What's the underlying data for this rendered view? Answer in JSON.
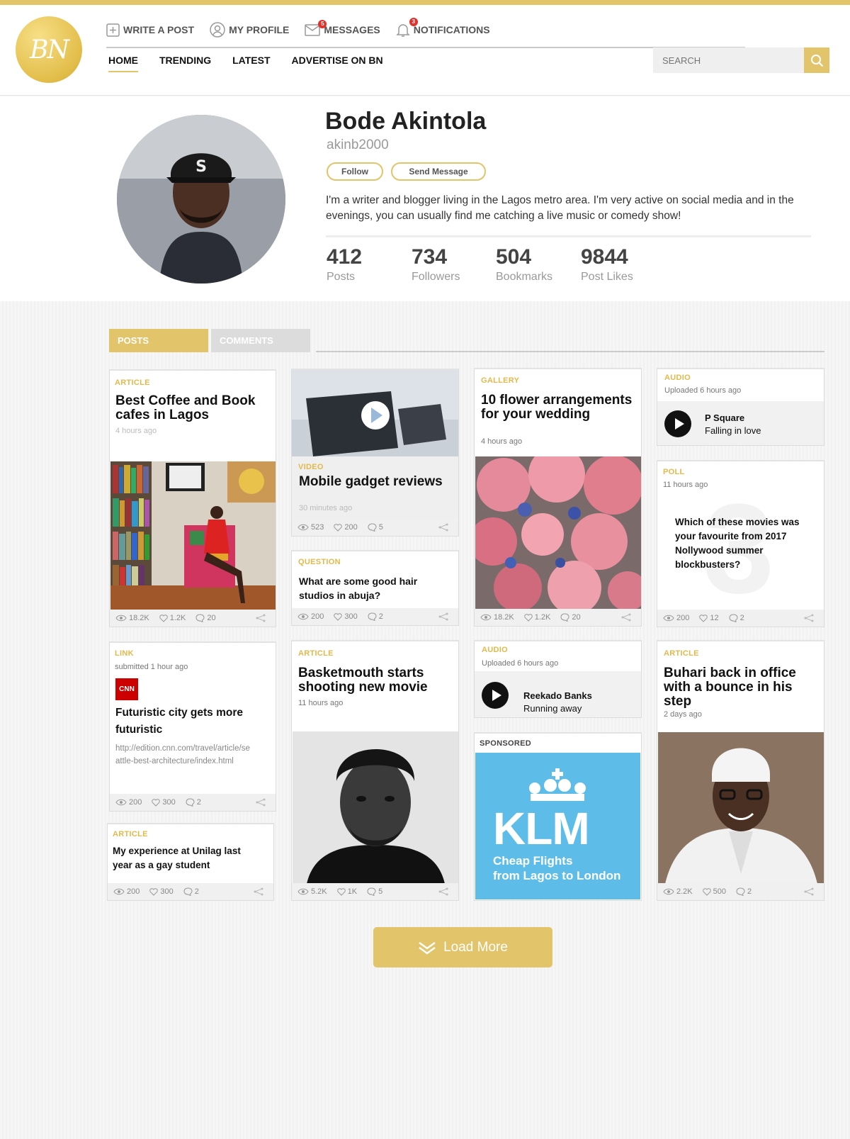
{
  "colors": {
    "accent": "#e2c46a",
    "accent_dark": "#e2b94c",
    "badge": "#e0322b",
    "klm_blue": "#5ebde8"
  },
  "logo": {
    "text": "BN"
  },
  "toolbar": {
    "write_post": "WRITE A POST",
    "my_profile": "MY PROFILE",
    "messages": "MESSAGES",
    "messages_badge": "5",
    "notifications": "NOTIFICATIONS",
    "notifications_badge": "3"
  },
  "nav": {
    "home": "HOME",
    "trending": "TRENDING",
    "latest": "LATEST",
    "advertise": "ADVERTISE ON BN"
  },
  "search": {
    "placeholder": "SEARCH"
  },
  "profile": {
    "name": "Bode Akintola",
    "username": "akinb2000",
    "follow_label": "Follow",
    "message_label": "Send Message",
    "bio": "I'm a writer and blogger living in the Lagos metro area. I'm very active on social media and in the evenings, you can usually find me catching a live music or comedy show!",
    "stats": [
      {
        "value": "412",
        "label": "Posts"
      },
      {
        "value": "734",
        "label": "Followers"
      },
      {
        "value": "504",
        "label": "Bookmarks"
      },
      {
        "value": "9844",
        "label": "Post Likes"
      }
    ]
  },
  "tabs": {
    "posts": "POSTS",
    "comments": "COMMENTS"
  },
  "cards": {
    "c1": {
      "category": "ARTICLE",
      "title": "Best Coffee and Book cafes in Lagos",
      "time": "4 hours ago",
      "views": "18.2K",
      "likes": "1.2K",
      "comments": "20"
    },
    "c2": {
      "category": "VIDEO",
      "title": "Mobile gadget reviews",
      "time": "30 minutes ago",
      "views": "523",
      "likes": "200",
      "comments": "5"
    },
    "c3": {
      "category": "QUESTION",
      "title": "What are some good hair studios in abuja?",
      "views": "200",
      "likes": "300",
      "comments": "2"
    },
    "c4": {
      "category": "GALLERY",
      "title": "10 flower arrangements for your wedding",
      "time": "4 hours ago",
      "views": "18.2K",
      "likes": "1.2K",
      "comments": "20"
    },
    "c5": {
      "category": "AUDIO",
      "time": "Uploaded 6 hours ago",
      "artist": "P Square",
      "track": "Falling in love"
    },
    "c6": {
      "category": "POLL",
      "time": "11 hours ago",
      "question": "Which of these movies was your favourite from 2017 Nollywood summer blockbusters?",
      "bg_number": "3",
      "views": "200",
      "likes": "12",
      "comments": "2"
    },
    "c7": {
      "category": "LINK",
      "time": "submitted 1 hour ago",
      "source": "CNN",
      "title": "Futuristic city gets more futuristic",
      "url": "http://edition.cnn.com/travel/article/seattle-best-architecture/index.html",
      "views": "200",
      "likes": "300",
      "comments": "2"
    },
    "c8": {
      "category": "ARTICLE",
      "title": "My experience at Unilag last year as a gay student",
      "views": "200",
      "likes": "300",
      "comments": "2"
    },
    "c9": {
      "category": "ARTICLE",
      "title": "Basketmouth starts shooting new movie",
      "time": "11 hours ago",
      "views": "5.2K",
      "likes": "1K",
      "comments": "5"
    },
    "c10": {
      "category": "AUDIO",
      "time": "Uploaded 6 hours ago",
      "artist": "Reekado Banks",
      "track": "Running away"
    },
    "c11": {
      "category": "SPONSORED",
      "brand": "KLM",
      "tagline1": "Cheap Flights",
      "tagline2": "from Lagos to London"
    },
    "c12": {
      "category": "ARTICLE",
      "title": "Buhari back in office with a bounce in his step",
      "time": "2 days ago",
      "views": "2.2K",
      "likes": "500",
      "comments": "2"
    }
  },
  "load_more": "Load More"
}
